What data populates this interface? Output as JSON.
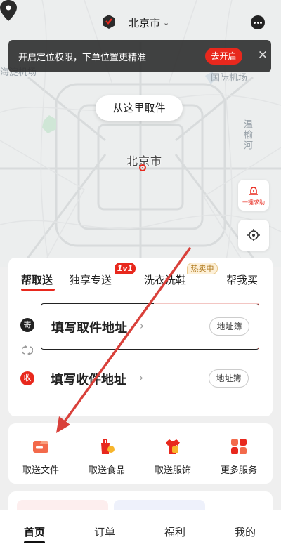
{
  "header": {
    "city": "北京市",
    "logo_icon": "app-logo-icon",
    "more_icon": "more-dots-icon"
  },
  "banner": {
    "text": "开启定位权限，下单位置更精准",
    "button": "去开启",
    "close_icon": "close-icon"
  },
  "map": {
    "labels": {
      "airport": "国际机场",
      "river": "温榆河",
      "haidian": "海淀机场"
    },
    "pickup_bubble": "从这里取件",
    "pin_label": "北京市",
    "sos_label": "一键求助",
    "locate_icon": "locate-icon"
  },
  "order": {
    "tabs": [
      {
        "label": "帮取送",
        "active": true
      },
      {
        "label": "独享专送",
        "active": false
      },
      {
        "label": "洗衣洗鞋",
        "active": false
      },
      {
        "label": "帮我买",
        "active": false
      }
    ],
    "badge_1v1": "1v1",
    "badge_hot": "热卖中",
    "send_marker": "寄",
    "recv_marker": "收",
    "pickup": {
      "text": "填写取件地址",
      "book": "地址簿"
    },
    "deliver": {
      "text": "填写收件地址",
      "book": "地址簿"
    }
  },
  "services": [
    {
      "label": "取送文件",
      "icon": "document-icon"
    },
    {
      "label": "取送食品",
      "icon": "food-icon"
    },
    {
      "label": "取送服饰",
      "icon": "clothing-icon"
    },
    {
      "label": "更多服务",
      "icon": "grid-icon"
    }
  ],
  "nav": [
    {
      "label": "首页",
      "active": true
    },
    {
      "label": "订单",
      "active": false
    },
    {
      "label": "福利",
      "active": false
    },
    {
      "label": "我的",
      "active": false
    }
  ],
  "colors": {
    "accent": "#e8281d",
    "banner_bg": "#2d2d2d",
    "annotation_arrow": "#d9403a"
  }
}
